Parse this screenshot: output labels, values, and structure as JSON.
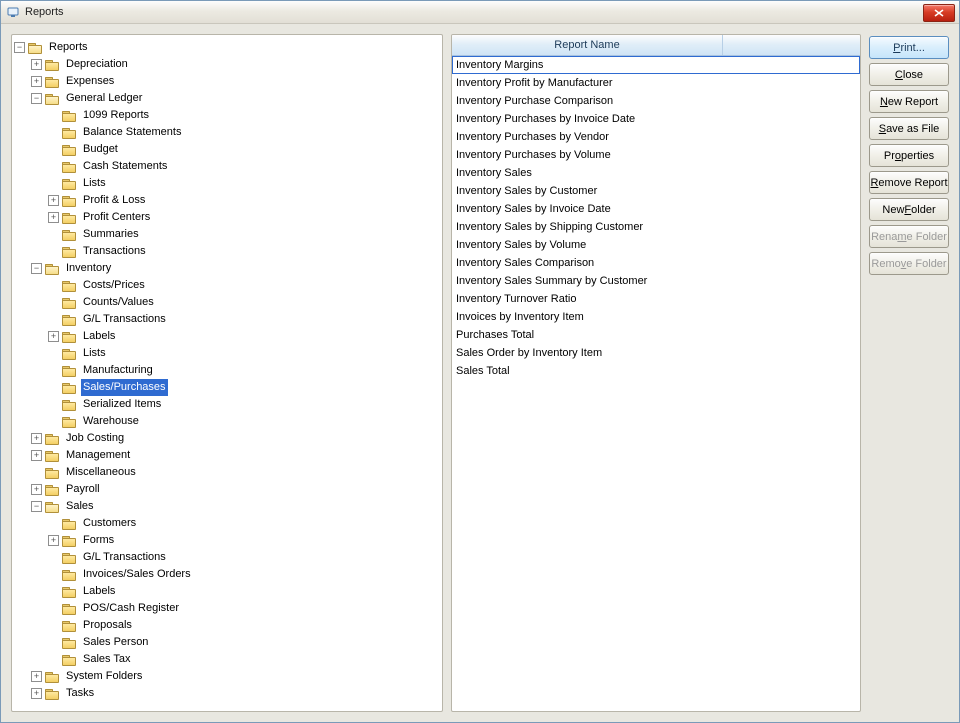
{
  "window": {
    "title": "Reports"
  },
  "list": {
    "header": "Report Name",
    "selected_index": 0,
    "items": [
      "Inventory Margins",
      "Inventory Profit by Manufacturer",
      "Inventory Purchase Comparison",
      "Inventory Purchases by Invoice Date",
      "Inventory Purchases by Vendor",
      "Inventory Purchases by Volume",
      "Inventory Sales",
      "Inventory Sales by Customer",
      "Inventory Sales by Invoice Date",
      "Inventory Sales by Shipping Customer",
      "Inventory Sales by Volume",
      "Inventory Sales Comparison",
      "Inventory Sales Summary by Customer",
      "Inventory Turnover Ratio",
      "Invoices by Inventory Item",
      "Purchases Total",
      "Sales Order by Inventory Item",
      "Sales Total"
    ]
  },
  "buttons": {
    "print": "Print...",
    "close": "Close",
    "new_report": "New Report",
    "save_as_file": "Save as File",
    "properties": "Properties",
    "remove_report": "Remove Report",
    "new_folder": "New Folder",
    "rename_folder": "Rename Folder",
    "remove_folder": "Remove Folder"
  },
  "underlines": {
    "print": "P",
    "close": "C",
    "new_report": "N",
    "save_as_file": "S",
    "properties": "o",
    "remove_report": "R",
    "new_folder": "F",
    "rename_folder": "m",
    "remove_folder": "v"
  },
  "tree": [
    {
      "label": "Reports",
      "expander": "minus",
      "open": true,
      "level": 0
    },
    {
      "label": "Depreciation",
      "expander": "plus",
      "level": 1
    },
    {
      "label": "Expenses",
      "expander": "plus",
      "level": 1
    },
    {
      "label": "General Ledger",
      "expander": "minus",
      "open": true,
      "level": 1
    },
    {
      "label": "1099 Reports",
      "expander": "none",
      "level": 2
    },
    {
      "label": "Balance Statements",
      "expander": "none",
      "level": 2
    },
    {
      "label": "Budget",
      "expander": "none",
      "level": 2
    },
    {
      "label": "Cash Statements",
      "expander": "none",
      "level": 2
    },
    {
      "label": "Lists",
      "expander": "none",
      "level": 2
    },
    {
      "label": "Profit & Loss",
      "expander": "plus",
      "level": 2
    },
    {
      "label": "Profit Centers",
      "expander": "plus",
      "level": 2
    },
    {
      "label": "Summaries",
      "expander": "none",
      "level": 2
    },
    {
      "label": "Transactions",
      "expander": "none",
      "level": 2
    },
    {
      "label": "Inventory",
      "expander": "minus",
      "open": true,
      "level": 1
    },
    {
      "label": "Costs/Prices",
      "expander": "none",
      "level": 2
    },
    {
      "label": "Counts/Values",
      "expander": "none",
      "level": 2
    },
    {
      "label": "G/L Transactions",
      "expander": "none",
      "level": 2
    },
    {
      "label": "Labels",
      "expander": "plus",
      "level": 2
    },
    {
      "label": "Lists",
      "expander": "none",
      "level": 2
    },
    {
      "label": "Manufacturing",
      "expander": "none",
      "level": 2
    },
    {
      "label": "Sales/Purchases",
      "expander": "none",
      "level": 2,
      "selected": true
    },
    {
      "label": "Serialized Items",
      "expander": "none",
      "level": 2
    },
    {
      "label": "Warehouse",
      "expander": "none",
      "level": 2
    },
    {
      "label": "Job Costing",
      "expander": "plus",
      "level": 1
    },
    {
      "label": "Management",
      "expander": "plus",
      "level": 1
    },
    {
      "label": "Miscellaneous",
      "expander": "none",
      "level": 1
    },
    {
      "label": "Payroll",
      "expander": "plus",
      "level": 1
    },
    {
      "label": "Sales",
      "expander": "minus",
      "open": true,
      "level": 1
    },
    {
      "label": "Customers",
      "expander": "none",
      "level": 2
    },
    {
      "label": "Forms",
      "expander": "plus",
      "level": 2
    },
    {
      "label": "G/L Transactions",
      "expander": "none",
      "level": 2
    },
    {
      "label": "Invoices/Sales Orders",
      "expander": "none",
      "level": 2
    },
    {
      "label": "Labels",
      "expander": "none",
      "level": 2
    },
    {
      "label": "POS/Cash Register",
      "expander": "none",
      "level": 2
    },
    {
      "label": "Proposals",
      "expander": "none",
      "level": 2
    },
    {
      "label": "Sales Person",
      "expander": "none",
      "level": 2
    },
    {
      "label": "Sales Tax",
      "expander": "none",
      "level": 2
    },
    {
      "label": "System Folders",
      "expander": "plus",
      "level": 1
    },
    {
      "label": "Tasks",
      "expander": "plus",
      "level": 1
    }
  ]
}
